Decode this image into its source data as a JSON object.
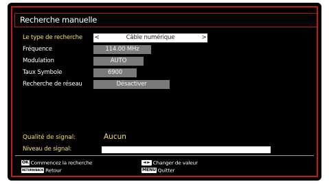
{
  "title": "Recherche manuelle",
  "settings": {
    "search_type_label": "Le type de recherche",
    "search_type_value": "Câble numérique",
    "frequency_label": "Fréquence",
    "frequency_value": "114.00 MHz",
    "modulation_label": "Modulation",
    "modulation_value": "AUTO",
    "symbol_rate_label": "Taux Symbole",
    "symbol_rate_value": "6900",
    "network_search_label": "Recherche de réseau",
    "network_search_value": "Désactiver"
  },
  "signal": {
    "quality_label": "Qualité de signal:",
    "quality_value": "Aucun",
    "level_label": "Niveau de signal:"
  },
  "footer": {
    "ok_key": "OK",
    "ok_text": "Commencez la recherche",
    "back_key": "RETURN/BACK",
    "back_text": "Retour",
    "change_key": "◄ ►",
    "change_text": "Changer de valeur",
    "menu_key": "MENU",
    "menu_text": "Quitter"
  },
  "colors": {
    "accent_red": "#c31a1a",
    "label_yellow": "#f3e262",
    "field_grey": "#7a7a7a"
  }
}
